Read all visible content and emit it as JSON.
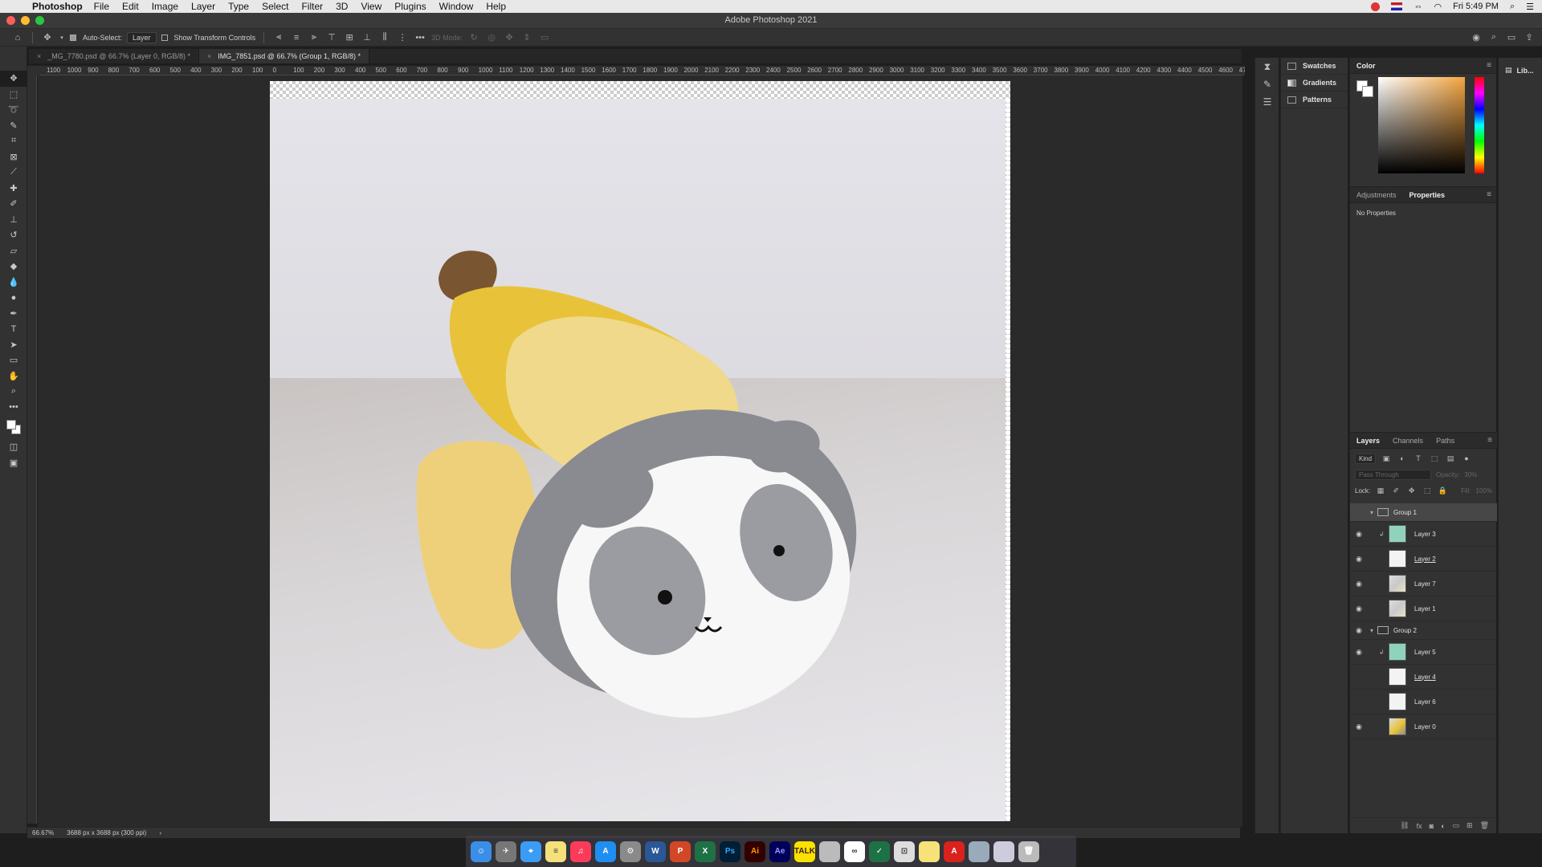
{
  "menubar": {
    "app": "Photoshop",
    "items": [
      "File",
      "Edit",
      "Image",
      "Layer",
      "Type",
      "Select",
      "Filter",
      "3D",
      "View",
      "Plugins",
      "Window",
      "Help"
    ],
    "clock": "Fri 5:49 PM"
  },
  "window": {
    "title": "Adobe Photoshop 2021"
  },
  "options": {
    "auto_select_label": "Auto-Select:",
    "auto_select_value": "Layer",
    "show_transform_label": "Show Transform Controls",
    "mode_3d_label": "3D Mode:"
  },
  "tabs": [
    {
      "label": "_MG_7780.psd @ 66.7% (Layer 0, RGB/8) *"
    },
    {
      "label": "IMG_7851.psd @ 66.7% (Group 1, RGB/8) *"
    }
  ],
  "ruler": {
    "labels": [
      "1100",
      "1000",
      "900",
      "800",
      "700",
      "600",
      "500",
      "400",
      "300",
      "200",
      "100",
      "0",
      "100",
      "200",
      "300",
      "400",
      "500",
      "600",
      "700",
      "800",
      "900",
      "1000",
      "1100",
      "1200",
      "1300",
      "1400",
      "1500",
      "1600",
      "1700",
      "1800",
      "1900",
      "2000",
      "2100",
      "2200",
      "2300",
      "2400",
      "2500",
      "2600",
      "2700",
      "2800",
      "2900",
      "3000",
      "3100",
      "3200",
      "3300",
      "3400",
      "3500",
      "3600",
      "3700",
      "3800",
      "3900",
      "4000",
      "4100",
      "4200",
      "4300",
      "4400",
      "4500",
      "4600",
      "4700",
      "48"
    ]
  },
  "status": {
    "zoom": "66.67%",
    "doc_info": "3688 px x 3688 px (300 ppi)"
  },
  "side_panels": {
    "swatches": "Swatches",
    "gradients": "Gradients",
    "patterns": "Patterns"
  },
  "color_panel": {
    "tab": "Color"
  },
  "properties": {
    "tabs": [
      "Adjustments",
      "Properties"
    ],
    "empty_text": "No Properties"
  },
  "libraries_label": "Lib...",
  "layers": {
    "tabs": [
      "Layers",
      "Channels",
      "Paths"
    ],
    "kind_label": "Kind",
    "blend_mode": "Pass Through",
    "opacity_label": "Opacity:",
    "opacity_value": "30%",
    "lock_label": "Lock:",
    "fill_label": "Fill:",
    "fill_value": "100%",
    "items": [
      {
        "name": "Group 1",
        "type": "group",
        "visible": false,
        "selected": true
      },
      {
        "name": "Layer 3",
        "type": "teal",
        "visible": true,
        "clipped": true
      },
      {
        "name": "Layer 2",
        "type": "white",
        "visible": true,
        "underline": true
      },
      {
        "name": "Layer 7",
        "type": "photo",
        "visible": true
      },
      {
        "name": "Layer 1",
        "type": "photo",
        "visible": true
      },
      {
        "name": "Group 2",
        "type": "group",
        "visible": true
      },
      {
        "name": "Layer 5",
        "type": "teal",
        "visible": true,
        "clipped": true
      },
      {
        "name": "Layer 4",
        "type": "white",
        "visible": false,
        "underline": true
      },
      {
        "name": "Layer 6",
        "type": "white",
        "visible": false
      },
      {
        "name": "Layer 0",
        "type": "photo",
        "visible": true
      }
    ]
  },
  "dock": [
    "Finder",
    "Launchpad",
    "Safari",
    "Notes",
    "Music",
    "App Store",
    "System Preferences",
    "Word",
    "PowerPoint",
    "Excel",
    "Ps",
    "Ai",
    "Ae",
    "Talk",
    "Files",
    "Line",
    "Sheets",
    "Preview",
    "Stickies",
    "Acrobat",
    "Photos",
    "Downloads",
    "Trash"
  ]
}
